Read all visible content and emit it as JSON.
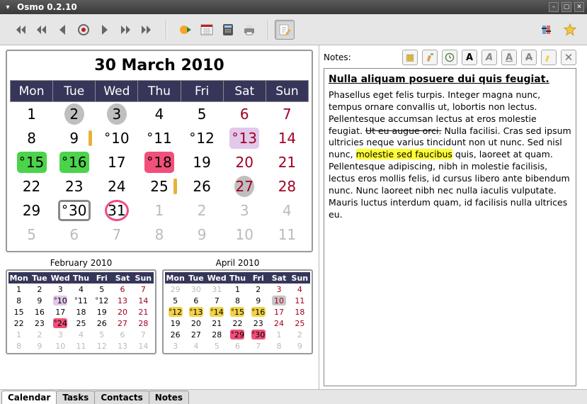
{
  "window": {
    "title": "Osmo 0.2.10"
  },
  "tabs": [
    "Calendar",
    "Tasks",
    "Contacts",
    "Notes"
  ],
  "active_tab": "Calendar",
  "notes_label": "Notes:",
  "calendar": {
    "title": "30 March 2010",
    "headers": [
      "Mon",
      "Tue",
      "Wed",
      "Thu",
      "Fri",
      "Sat",
      "Sun"
    ],
    "days": [
      [
        {
          "n": 1
        },
        {
          "n": 2,
          "grey": true
        },
        {
          "n": 3,
          "grey": true
        },
        {
          "n": 4
        },
        {
          "n": 5
        },
        {
          "n": 6,
          "we": true
        },
        {
          "n": 7,
          "we": true
        }
      ],
      [
        {
          "n": 8
        },
        {
          "n": 9,
          "bar": true
        },
        {
          "n": 10,
          "dot": true
        },
        {
          "n": 11,
          "dot": true
        },
        {
          "n": 12,
          "dot": true
        },
        {
          "n": 13,
          "we": true,
          "dot": true,
          "lav": true
        },
        {
          "n": 14,
          "we": true
        }
      ],
      [
        {
          "n": 15,
          "dot": true,
          "green": true
        },
        {
          "n": 16,
          "dot": true,
          "green": true
        },
        {
          "n": 17
        },
        {
          "n": 18,
          "dot": true,
          "pink": true
        },
        {
          "n": 19
        },
        {
          "n": 20,
          "we": true
        },
        {
          "n": 21,
          "we": true
        }
      ],
      [
        {
          "n": 22
        },
        {
          "n": 23
        },
        {
          "n": 24
        },
        {
          "n": 25,
          "bar": true
        },
        {
          "n": 26
        },
        {
          "n": 27,
          "we": true,
          "grey": true
        },
        {
          "n": 28,
          "we": true
        }
      ],
      [
        {
          "n": 29
        },
        {
          "n": 30,
          "dot": true,
          "today": true
        },
        {
          "n": 31,
          "circle": true
        },
        {
          "n": 1,
          "dim": true
        },
        {
          "n": 2,
          "dim": true
        },
        {
          "n": 3,
          "dim": true,
          "we": true
        },
        {
          "n": 4,
          "dim": true,
          "we": true
        }
      ],
      [
        {
          "n": 5,
          "dim": true
        },
        {
          "n": 6,
          "dim": true
        },
        {
          "n": 7,
          "dim": true
        },
        {
          "n": 8,
          "dim": true
        },
        {
          "n": 9,
          "dim": true
        },
        {
          "n": 10,
          "dim": true,
          "we": true
        },
        {
          "n": 11,
          "dim": true,
          "we": true
        }
      ]
    ]
  },
  "mini": [
    {
      "title": "February 2010",
      "headers": [
        "Mon",
        "Tue",
        "Wed",
        "Thu",
        "Fri",
        "Sat",
        "Sun"
      ],
      "rows": [
        [
          {
            "n": 1
          },
          {
            "n": 2
          },
          {
            "n": 3
          },
          {
            "n": 4
          },
          {
            "n": 5
          },
          {
            "n": 6,
            "we": true
          },
          {
            "n": 7,
            "we": true
          }
        ],
        [
          {
            "n": 8
          },
          {
            "n": 9
          },
          {
            "n": 10,
            "dot": true,
            "lav": true
          },
          {
            "n": 11,
            "dot": true
          },
          {
            "n": 12,
            "dot": true
          },
          {
            "n": 13,
            "we": true
          },
          {
            "n": 14,
            "we": true
          }
        ],
        [
          {
            "n": 15
          },
          {
            "n": 16
          },
          {
            "n": 17
          },
          {
            "n": 18
          },
          {
            "n": 19
          },
          {
            "n": 20,
            "we": true
          },
          {
            "n": 21,
            "we": true
          }
        ],
        [
          {
            "n": 22
          },
          {
            "n": 23
          },
          {
            "n": 24,
            "dot": true,
            "pink": true
          },
          {
            "n": 25
          },
          {
            "n": 26
          },
          {
            "n": 27,
            "we": true
          },
          {
            "n": 28,
            "we": true
          }
        ],
        [
          {
            "n": 1,
            "dim": true
          },
          {
            "n": 2,
            "dim": true
          },
          {
            "n": 3,
            "dim": true
          },
          {
            "n": 4,
            "dim": true
          },
          {
            "n": 5,
            "dim": true
          },
          {
            "n": 6,
            "dim": true,
            "we": true
          },
          {
            "n": 7,
            "dim": true,
            "we": true
          }
        ],
        [
          {
            "n": 8,
            "dim": true
          },
          {
            "n": 9,
            "dim": true
          },
          {
            "n": 10,
            "dim": true
          },
          {
            "n": 11,
            "dim": true
          },
          {
            "n": 12,
            "dim": true
          },
          {
            "n": 13,
            "dim": true,
            "we": true
          },
          {
            "n": 14,
            "dim": true,
            "we": true
          }
        ]
      ]
    },
    {
      "title": "April 2010",
      "headers": [
        "Mon",
        "Tue",
        "Wed",
        "Thu",
        "Fri",
        "Sat",
        "Sun"
      ],
      "rows": [
        [
          {
            "n": 29,
            "dim": true
          },
          {
            "n": 30,
            "dim": true
          },
          {
            "n": 31,
            "dim": true
          },
          {
            "n": 1
          },
          {
            "n": 2
          },
          {
            "n": 3,
            "we": true
          },
          {
            "n": 4,
            "we": true
          }
        ],
        [
          {
            "n": 5
          },
          {
            "n": 6
          },
          {
            "n": 7
          },
          {
            "n": 8
          },
          {
            "n": 9
          },
          {
            "n": 10,
            "we": true,
            "grey": true
          },
          {
            "n": 11,
            "we": true
          }
        ],
        [
          {
            "n": 12,
            "dot": true,
            "yel": true
          },
          {
            "n": 13,
            "dot": true,
            "yel": true
          },
          {
            "n": 14,
            "dot": true,
            "yel": true
          },
          {
            "n": 15,
            "dot": true,
            "yel": true
          },
          {
            "n": 16,
            "dot": true,
            "yel": true
          },
          {
            "n": 17,
            "we": true
          },
          {
            "n": 18,
            "we": true
          }
        ],
        [
          {
            "n": 19
          },
          {
            "n": 20
          },
          {
            "n": 21
          },
          {
            "n": 22
          },
          {
            "n": 23
          },
          {
            "n": 24,
            "we": true
          },
          {
            "n": 25,
            "we": true
          }
        ],
        [
          {
            "n": 26
          },
          {
            "n": 27
          },
          {
            "n": 28
          },
          {
            "n": 29,
            "dot": true,
            "pink": true
          },
          {
            "n": 30,
            "dot": true,
            "pink": true
          },
          {
            "n": 1,
            "we": true,
            "dim": true
          },
          {
            "n": 2,
            "we": true,
            "dim": true
          }
        ],
        [
          {
            "n": 3,
            "dim": true
          },
          {
            "n": 4,
            "dim": true
          },
          {
            "n": 5,
            "dim": true
          },
          {
            "n": 6,
            "dim": true
          },
          {
            "n": 7,
            "dim": true
          },
          {
            "n": 8,
            "dim": true,
            "we": true
          },
          {
            "n": 9,
            "dim": true,
            "we": true
          }
        ]
      ]
    }
  ],
  "note": {
    "title": "Nulla aliquam posuere dui quis feugiat.",
    "body_pre": "Phasellus eget felis turpis. Integer magna nunc, tempus ornare convallis ut, lobortis non lectus. Pellentesque accumsan lectus at eros molestie feugiat. ",
    "strike": "Ut eu augue orci.",
    "body_mid": " Nulla facilisi. Cras sed ipsum ultricies neque varius tincidunt non ut nunc. Sed nisl nunc, ",
    "highlight": "molestie sed faucibus",
    "body_post": " quis, laoreet at quam. Pellentesque adipiscing, nibh in molestie facilisis, lectus eros mollis felis, id cursus libero ante bibendum nunc. Nunc laoreet nibh nec nulla iaculis vulputate. Mauris luctus interdum quam, id facilisis nulla ultrices eu."
  }
}
